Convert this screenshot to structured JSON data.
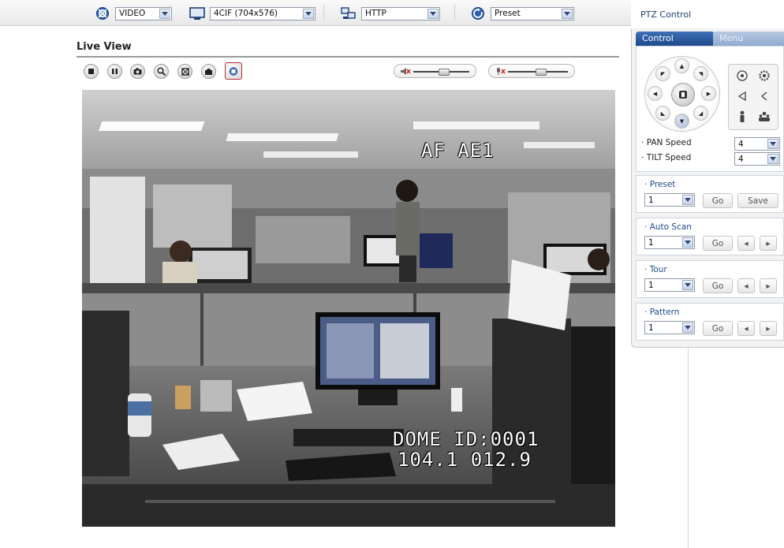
{
  "toolbar": {
    "video_label": "VIDEO",
    "resolution": "4CIF (704x576)",
    "protocol": "HTTP",
    "preset": "Preset"
  },
  "live_view": {
    "title": "Live View",
    "osd_top": "AF AE1",
    "osd_dome": "DOME ID:0001",
    "osd_coords": "104.1 012.9",
    "controls": [
      "stop-icon",
      "pause-icon",
      "snapshot-icon",
      "zoom-icon",
      "fullscreen-icon",
      "record-icon",
      "ptz-icon"
    ],
    "speaker_level": 0.55,
    "mic_level": 0.55
  },
  "ptz": {
    "title": "PTZ Control",
    "tab_control": "Control",
    "tab_menu": "Menu",
    "pan_label": "PAN Speed",
    "pan_value": "4",
    "tilt_label": "TILT Speed",
    "tilt_value": "4",
    "preset_label": "Preset",
    "preset_value": "1",
    "go": "Go",
    "save": "Save",
    "autoscan_label": "Auto Scan",
    "autoscan_value": "1",
    "tour_label": "Tour",
    "tour_value": "1",
    "pattern_label": "Pattern",
    "pattern_value": "1",
    "prev": "◂",
    "next": "▸"
  }
}
